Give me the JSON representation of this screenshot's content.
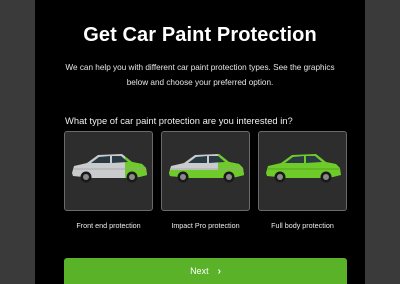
{
  "page": {
    "title": "Get Car Paint Protection",
    "intro": "We can help you with different car paint protection types. See the graphics below and choose your preferred option.",
    "question": "What type of car paint protection are you interested in?"
  },
  "options": [
    {
      "label": "Front end protection",
      "icon": "car-front-end-icon"
    },
    {
      "label": "Impact Pro protection",
      "icon": "car-impact-pro-icon"
    },
    {
      "label": "Full body protection",
      "icon": "car-full-body-icon"
    }
  ],
  "next_button": {
    "label": "Next",
    "icon": "chevron-right-icon"
  },
  "colors": {
    "accent": "#59b228",
    "panel": "#000000",
    "car_silver": "#c9cbcd",
    "car_green": "#6fcb2a"
  }
}
